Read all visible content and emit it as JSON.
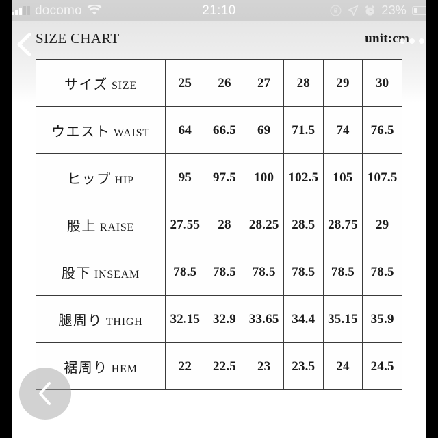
{
  "status_bar": {
    "carrier": "docomo",
    "time": "21:10",
    "battery_percent": "23%",
    "icons": [
      "signal-bars-icon",
      "wifi-icon",
      "rotation-lock-icon",
      "location-arrow-icon",
      "alarm-clock-icon",
      "battery-icon"
    ]
  },
  "header": {
    "title": "SIZE CHART",
    "unit": "unit:cm"
  },
  "overlays": {
    "back_chevron": "chevron-left-icon",
    "more_dots": "more-options-icon",
    "floating_back": "chevron-left-icon"
  },
  "chart_data": {
    "type": "table",
    "title": "SIZE CHART",
    "unit": "cm",
    "columns": [
      "サイズ SIZE",
      "25",
      "26",
      "27",
      "28",
      "29",
      "30"
    ],
    "header_row": {
      "label_jp": "サイズ",
      "label_en": "SIZE",
      "values": [
        "25",
        "26",
        "27",
        "28",
        "29",
        "30"
      ]
    },
    "rows": [
      {
        "label_jp": "ウエスト",
        "label_en": "WAIST",
        "values": [
          "64",
          "66.5",
          "69",
          "71.5",
          "74",
          "76.5"
        ]
      },
      {
        "label_jp": "ヒップ",
        "label_en": "HIP",
        "values": [
          "95",
          "97.5",
          "100",
          "102.5",
          "105",
          "107.5"
        ]
      },
      {
        "label_jp": "股上",
        "label_en": "RAISE",
        "values": [
          "27.55",
          "28",
          "28.25",
          "28.5",
          "28.75",
          "29"
        ]
      },
      {
        "label_jp": "股下",
        "label_en": "INSEAM",
        "values": [
          "78.5",
          "78.5",
          "78.5",
          "78.5",
          "78.5",
          "78.5"
        ]
      },
      {
        "label_jp": "腿周り",
        "label_en": "THIGH",
        "values": [
          "32.15",
          "32.9",
          "33.65",
          "34.4",
          "35.15",
          "35.9"
        ]
      },
      {
        "label_jp": "裾周り",
        "label_en": "HEM",
        "values": [
          "22",
          "22.5",
          "23",
          "23.5",
          "24",
          "24.5"
        ]
      }
    ]
  }
}
